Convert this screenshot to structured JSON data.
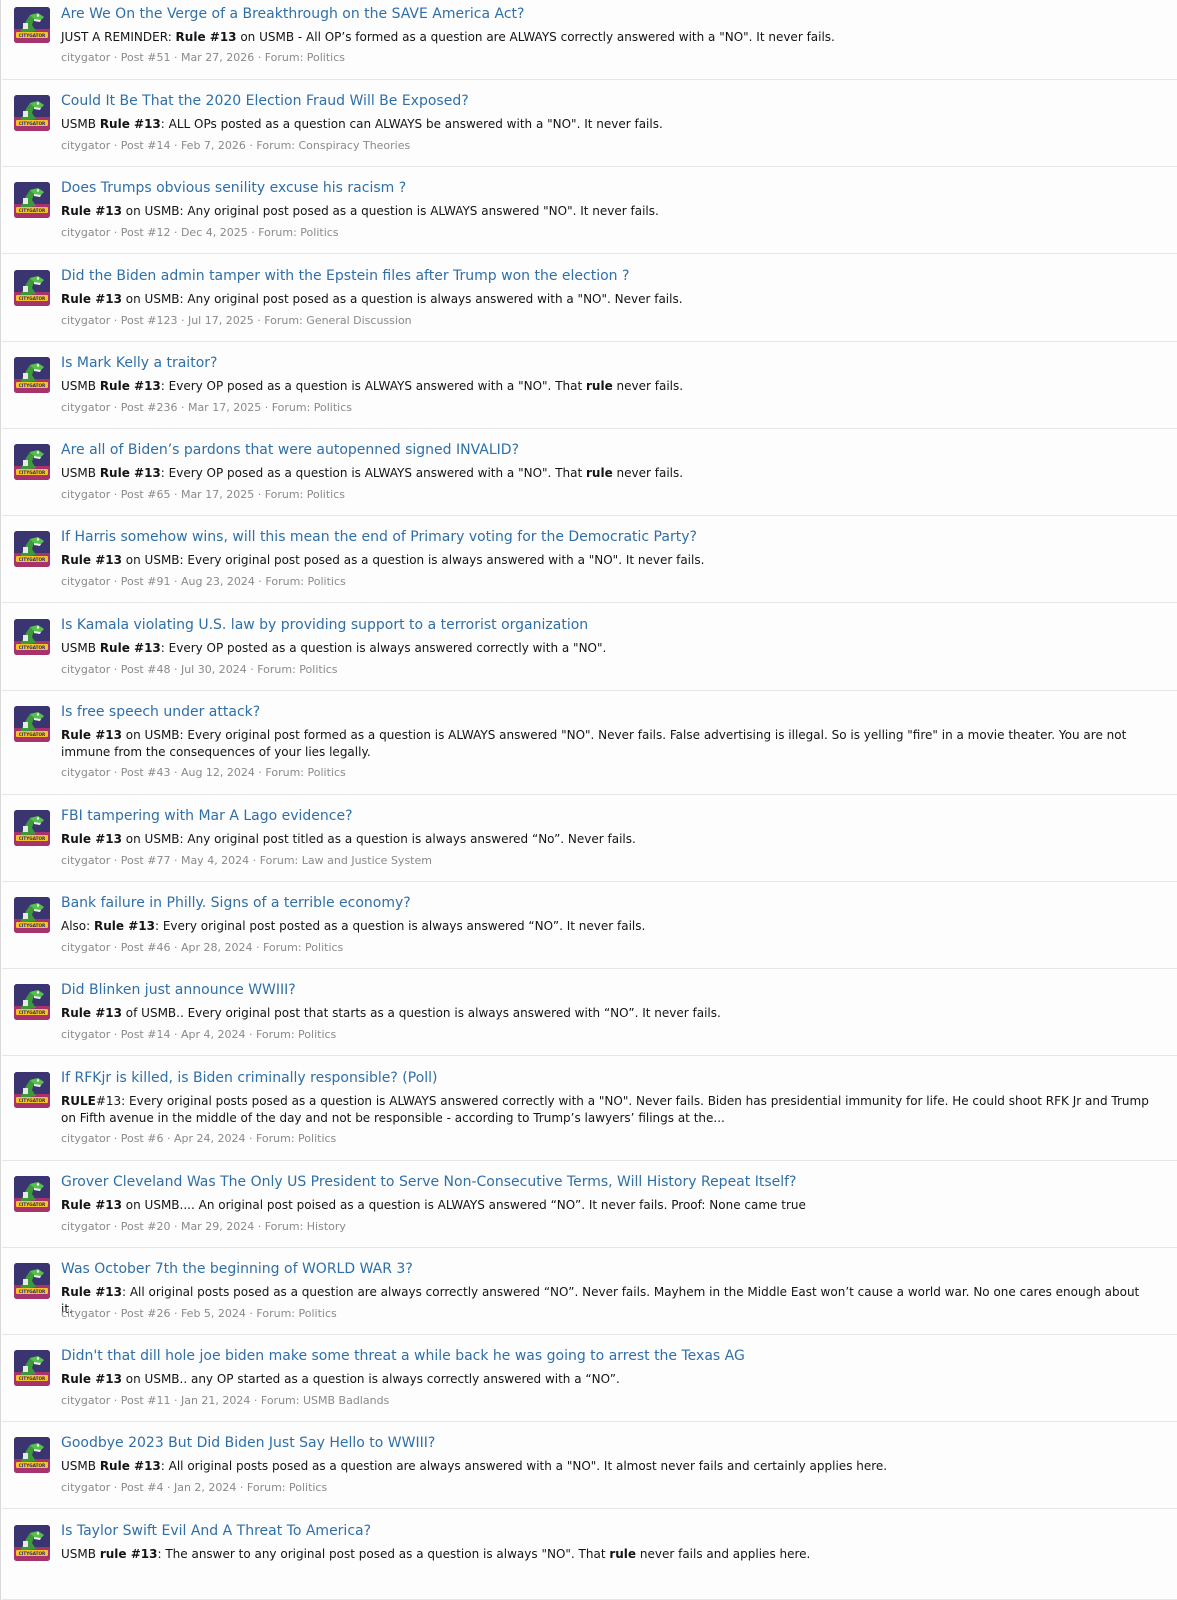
{
  "results": [
    {
      "title": "Are We On the Verge of a Breakthrough on the SAVE America Act?",
      "snippet": [
        {
          "t": "JUST A REMINDER: "
        },
        {
          "t": "Rule #13",
          "b": true
        },
        {
          "t": " on USMB - All OP’s formed as a question are ALWAYS correctly answered with a \"NO\". It never fails."
        }
      ],
      "author": "citygator",
      "post": "Post #51",
      "date": "Mar 27, 2026",
      "forum": "Forum: Politics"
    },
    {
      "title": "Could It Be That the 2020 Election Fraud Will Be Exposed?",
      "snippet": [
        {
          "t": "USMB "
        },
        {
          "t": "Rule #13",
          "b": true
        },
        {
          "t": ": ALL OPs posted as a question can ALWAYS be answered with a \"NO\". It never fails."
        }
      ],
      "author": "citygator",
      "post": "Post #14",
      "date": "Feb 7, 2026",
      "forum": "Forum: Conspiracy Theories"
    },
    {
      "title": "Does Trumps obvious senility excuse his racism ?",
      "snippet": [
        {
          "t": "Rule #13",
          "b": true
        },
        {
          "t": " on USMB: Any original post posed as a question is ALWAYS answered \"NO\". It never fails."
        }
      ],
      "author": "citygator",
      "post": "Post #12",
      "date": "Dec 4, 2025",
      "forum": "Forum: Politics"
    },
    {
      "title": "Did the Biden admin tamper with the Epstein files after Trump won the election ?",
      "snippet": [
        {
          "t": "Rule #13",
          "b": true
        },
        {
          "t": " on USMB: Any original post posed as a question is always answered with a \"NO\". Never fails."
        }
      ],
      "author": "citygator",
      "post": "Post #123",
      "date": "Jul 17, 2025",
      "forum": "Forum: General Discussion"
    },
    {
      "title": "Is Mark Kelly a traitor?",
      "snippet": [
        {
          "t": "USMB "
        },
        {
          "t": "Rule #13",
          "b": true
        },
        {
          "t": ": Every OP posed as a question is ALWAYS answered with a \"NO\". That "
        },
        {
          "t": "rule",
          "b": true
        },
        {
          "t": " never fails."
        }
      ],
      "author": "citygator",
      "post": "Post #236",
      "date": "Mar 17, 2025",
      "forum": "Forum: Politics"
    },
    {
      "title": "Are all of Biden’s pardons that were autopenned signed INVALID?",
      "snippet": [
        {
          "t": "USMB "
        },
        {
          "t": "Rule #13",
          "b": true
        },
        {
          "t": ": Every OP posed as a question is ALWAYS answered with a \"NO\". That "
        },
        {
          "t": "rule",
          "b": true
        },
        {
          "t": " never fails."
        }
      ],
      "author": "citygator",
      "post": "Post #65",
      "date": "Mar 17, 2025",
      "forum": "Forum: Politics"
    },
    {
      "title": "If Harris somehow wins, will this mean the end of Primary voting for the Democratic Party?",
      "snippet": [
        {
          "t": "Rule #13",
          "b": true
        },
        {
          "t": " on USMB: Every original post posed as a question is always answered with a \"NO\". It never fails."
        }
      ],
      "author": "citygator",
      "post": "Post #91",
      "date": "Aug 23, 2024",
      "forum": "Forum: Politics"
    },
    {
      "title": "Is Kamala violating U.S. law by providing support to a terrorist organization",
      "snippet": [
        {
          "t": "USMB "
        },
        {
          "t": "Rule #13",
          "b": true
        },
        {
          "t": ": Every OP posted as a question is always answered correctly with a \"NO\"."
        }
      ],
      "author": "citygator",
      "post": "Post #48",
      "date": "Jul 30, 2024",
      "forum": "Forum: Politics"
    },
    {
      "title": "Is free speech under attack?",
      "snippet": [
        {
          "t": "Rule #13",
          "b": true
        },
        {
          "t": " on USMB: Every original post formed as a question is ALWAYS answered \"NO\". Never fails. False advertising is illegal. So is yelling \"fire\" in a movie theater. You are not immune from the consequences of your lies legally."
        }
      ],
      "author": "citygator",
      "post": "Post #43",
      "date": "Aug 12, 2024",
      "forum": "Forum: Politics"
    },
    {
      "title": "FBI tampering with Mar A Lago evidence?",
      "snippet": [
        {
          "t": "Rule #13",
          "b": true
        },
        {
          "t": " on USMB: Any original post titled as a question is always answered “No”. Never fails."
        }
      ],
      "author": "citygator",
      "post": "Post #77",
      "date": "May 4, 2024",
      "forum": "Forum: Law and Justice System"
    },
    {
      "title": "Bank failure in Philly. Signs of a terrible economy?",
      "snippet": [
        {
          "t": "Also: "
        },
        {
          "t": "Rule #13",
          "b": true
        },
        {
          "t": ": Every original post posted as a question is always answered “NO”. It never fails."
        }
      ],
      "author": "citygator",
      "post": "Post #46",
      "date": "Apr 28, 2024",
      "forum": "Forum: Politics"
    },
    {
      "title": "Did Blinken just announce WWIII?",
      "snippet": [
        {
          "t": "Rule #13",
          "b": true
        },
        {
          "t": " of USMB.. Every original post that starts as a question is always answered with “NO”. It never fails."
        }
      ],
      "author": "citygator",
      "post": "Post #14",
      "date": "Apr 4, 2024",
      "forum": "Forum: Politics"
    },
    {
      "title": "If RFKjr is killed, is Biden criminally responsible? (Poll)",
      "snippet": [
        {
          "t": "RULE",
          "b": true
        },
        {
          "t": "#13: Every original posts posed as a question is ALWAYS answered correctly with a \"NO\". Never fails. Biden has presidential immunity for life. He could shoot RFK Jr and Trump on Fifth avenue in the middle of the day and not be responsible - according to Trump’s lawyers’ filings at the..."
        }
      ],
      "author": "citygator",
      "post": "Post #6",
      "date": "Apr 24, 2024",
      "forum": "Forum: Politics"
    },
    {
      "title": "Grover Cleveland Was The Only US President to Serve Non-Consecutive Terms, Will History Repeat Itself?",
      "snippet": [
        {
          "t": "Rule #13",
          "b": true
        },
        {
          "t": " on USMB.... An original post poised as a question is ALWAYS answered “NO”. It never fails. Proof: None came true"
        }
      ],
      "author": "citygator",
      "post": "Post #20",
      "date": "Mar 29, 2024",
      "forum": "Forum: History"
    },
    {
      "title": "Was October 7th the beginning of WORLD WAR 3?",
      "snippet": [
        {
          "t": "Rule #13",
          "b": true
        },
        {
          "t": ": All original posts posed as a question are always correctly answered “NO”. Never fails. Mayhem in the Middle East won’t cause a world war. No one cares enough about it."
        }
      ],
      "author": "citygator",
      "post": "Post #26",
      "date": "Feb 5, 2024",
      "forum": "Forum: Politics"
    },
    {
      "title": "Didn't that dill hole joe biden make some threat a while back he was going to arrest the Texas AG",
      "snippet": [
        {
          "t": "Rule #13",
          "b": true
        },
        {
          "t": " on USMB.. any OP started as a question is always correctly answered with a “NO”."
        }
      ],
      "author": "citygator",
      "post": "Post #11",
      "date": "Jan 21, 2024",
      "forum": "Forum: USMB Badlands"
    },
    {
      "title": "Goodbye 2023 But Did Biden Just Say Hello to WWIII?",
      "snippet": [
        {
          "t": "USMB "
        },
        {
          "t": "Rule #13",
          "b": true
        },
        {
          "t": ": All original posts posed as a question are always answered with a \"NO\". It almost never fails and certainly applies here."
        }
      ],
      "author": "citygator",
      "post": "Post #4",
      "date": "Jan 2, 2024",
      "forum": "Forum: Politics"
    },
    {
      "title": "Is Taylor Swift Evil And A Threat To America?",
      "snippet": [
        {
          "t": "USMB "
        },
        {
          "t": "rule #13",
          "b": true
        },
        {
          "t": ": The answer to any original post posed as a question is always \"NO\". That "
        },
        {
          "t": "rule",
          "b": true
        },
        {
          "t": " never fails and applies here."
        }
      ],
      "author": "",
      "post": "",
      "date": "",
      "forum": ""
    }
  ],
  "meta_separator": " · ",
  "avatar_caption": "CITYGATOR",
  "colors": {
    "link": "#2f6fa8",
    "meta": "#8a8a8a",
    "divider": "#e6e6e6"
  }
}
